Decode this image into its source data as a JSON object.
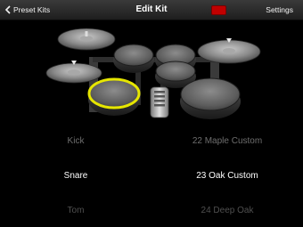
{
  "navbar": {
    "back_label": "Preset Kits",
    "title": "Edit Kit",
    "settings_label": "Settings",
    "record_color": "#c00000"
  },
  "kit": {
    "selected_piece": "snare",
    "highlight_color": "#e6e600",
    "pieces": [
      "crash-cymbal-left",
      "hihat-cymbal",
      "ride-cymbal",
      "tom-1",
      "tom-2",
      "tom-3",
      "snare",
      "kick-pedal",
      "floor-tom"
    ]
  },
  "piece_picker": {
    "items": [
      "Kick",
      "Snare",
      "Tom"
    ],
    "selected": "Snare"
  },
  "preset_picker": {
    "items": [
      "22 Maple Custom",
      "23 Oak Custom",
      "24 Deep Oak"
    ],
    "selected": "23 Oak Custom"
  }
}
